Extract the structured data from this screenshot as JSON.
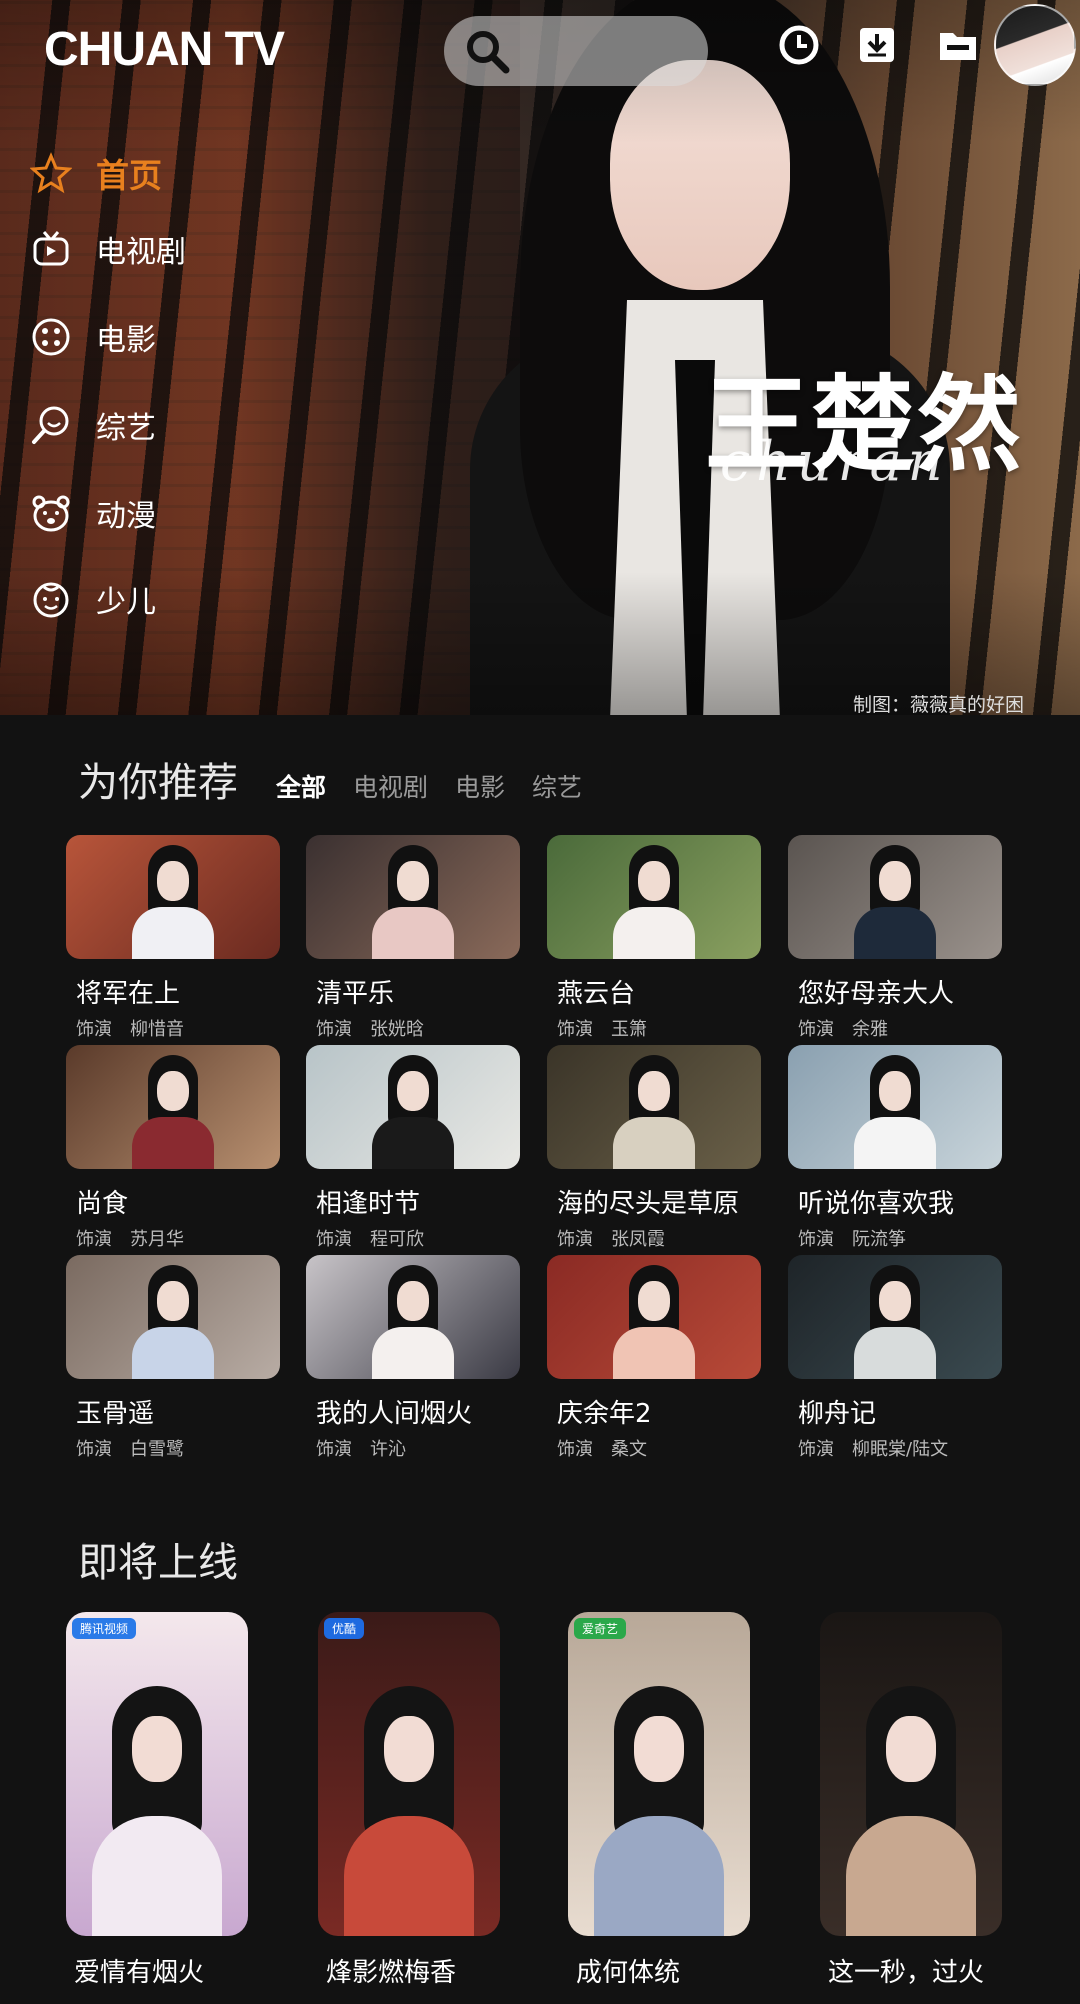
{
  "app": {
    "logo": "CHUAN TV"
  },
  "hero": {
    "title": "王楚然",
    "signature": "churan",
    "credit": "制图：薇薇真的好困"
  },
  "nav": [
    {
      "label": "首页",
      "icon": "star-icon",
      "active": true
    },
    {
      "label": "电视剧",
      "icon": "tv-icon"
    },
    {
      "label": "电影",
      "icon": "film-reel-icon"
    },
    {
      "label": "综艺",
      "icon": "search-bubble-icon"
    },
    {
      "label": "动漫",
      "icon": "bear-icon"
    },
    {
      "label": "少儿",
      "icon": "kid-face-icon"
    }
  ],
  "recommend": {
    "title": "为你推荐",
    "filters": [
      "全部",
      "电视剧",
      "电影",
      "综艺"
    ],
    "active_filter": "全部",
    "role_label": "饰演",
    "items": [
      {
        "title": "将军在上",
        "role": "饰演",
        "character": "柳惜音"
      },
      {
        "title": "清平乐",
        "role": "饰演",
        "character": "张姯晗"
      },
      {
        "title": "燕云台",
        "role": "饰演",
        "character": "玉箫"
      },
      {
        "title": "您好母亲大人",
        "role": "饰演",
        "character": "余雅"
      },
      {
        "title": "尚食",
        "role": "饰演",
        "character": "苏月华"
      },
      {
        "title": "相逢时节",
        "role": "饰演",
        "character": "程可欣"
      },
      {
        "title": "海的尽头是草原",
        "role": "饰演",
        "character": "张凤霞"
      },
      {
        "title": "听说你喜欢我",
        "role": "饰演",
        "character": "阮流筝"
      },
      {
        "title": "玉骨遥",
        "role": "饰演",
        "character": "白雪鹭"
      },
      {
        "title": "我的人间烟火",
        "role": "饰演",
        "character": "许沁"
      },
      {
        "title": "庆余年2",
        "role": "饰演",
        "character": "桑文"
      },
      {
        "title": "柳舟记",
        "role": "饰演",
        "character": "柳眠棠/陆文"
      }
    ]
  },
  "upcoming": {
    "title": "即将上线",
    "items": [
      {
        "title": "爱情有烟火",
        "tag": "腾讯视频"
      },
      {
        "title": "烽影燃梅香",
        "tag": "优酷"
      },
      {
        "title": "成何体统",
        "tag": "爱奇艺"
      },
      {
        "title": "这一秒，过火",
        "tag": ""
      }
    ]
  },
  "colors": {
    "accent": "#e8801e",
    "background": "#121212"
  }
}
